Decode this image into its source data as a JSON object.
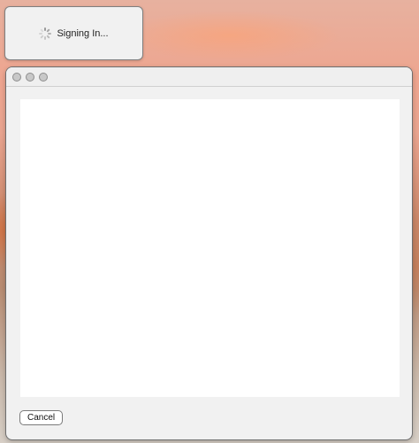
{
  "signin_dialog": {
    "status_text": "Signing In...",
    "spinner_icon": "activity-spinner-icon"
  },
  "window": {
    "traffic_lights": {
      "close": "close-icon",
      "minimize": "minimize-icon",
      "zoom": "zoom-icon"
    },
    "cancel_label": "Cancel"
  }
}
